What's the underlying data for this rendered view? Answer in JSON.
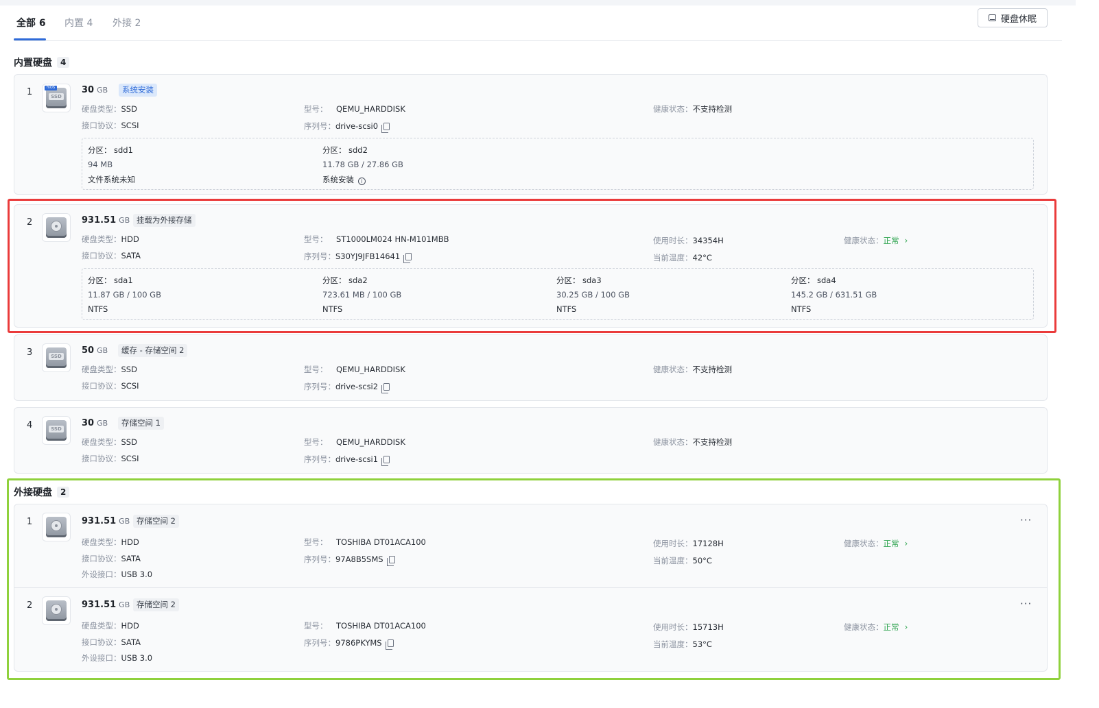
{
  "tabs": [
    {
      "label": "全部 6"
    },
    {
      "label": "内置 4"
    },
    {
      "label": "外接 2"
    }
  ],
  "sleep_button": "硬盘休眠",
  "labels": {
    "disk_type": "硬盘类型：",
    "model": "型号：",
    "health": "健康状态：",
    "interface": "接口协议：",
    "serial": "序列号：",
    "usage": "使用时长：",
    "temp": "当前温度：",
    "ext_port": "外设接口：",
    "partition": "分区："
  },
  "internal": {
    "title": "内置硬盘",
    "count": "4",
    "disks": [
      {
        "index": "1",
        "size": "30",
        "unit": "GB",
        "tag": "系统安装",
        "icon_badge": "fnOS",
        "icon_label": "SSD",
        "type": "SSD",
        "interface": "SCSI",
        "model": "QEMU_HARDDISK",
        "serial": "drive-scsi0",
        "health": "不支持检测",
        "partitions": [
          {
            "name": "sdd1",
            "size": "94 MB",
            "fs": "文件系统未知"
          },
          {
            "name": "sdd2",
            "size": "11.78 GB / 27.86 GB",
            "fs": "系统安装"
          }
        ]
      },
      {
        "index": "2",
        "size": "931.51",
        "unit": "GB",
        "tag": "挂载为外接存储",
        "type": "HDD",
        "interface": "SATA",
        "model": "ST1000LM024 HN-M101MBB",
        "serial": "S30YJ9JFB14641",
        "usage": "34354H",
        "temp": "42°C",
        "health": "正常",
        "partitions": [
          {
            "name": "sda1",
            "size": "11.87 GB / 100 GB",
            "fs": "NTFS"
          },
          {
            "name": "sda2",
            "size": "723.61 MB / 100 GB",
            "fs": "NTFS"
          },
          {
            "name": "sda3",
            "size": "30.25 GB / 100 GB",
            "fs": "NTFS"
          },
          {
            "name": "sda4",
            "size": "145.2 GB / 631.51 GB",
            "fs": "NTFS"
          }
        ]
      },
      {
        "index": "3",
        "size": "50",
        "unit": "GB",
        "tag": "缓存 - 存储空间 2",
        "icon_label": "SSD",
        "type": "SSD",
        "interface": "SCSI",
        "model": "QEMU_HARDDISK",
        "serial": "drive-scsi2",
        "health": "不支持检测"
      },
      {
        "index": "4",
        "size": "30",
        "unit": "GB",
        "tag": "存储空间 1",
        "icon_label": "SSD",
        "type": "SSD",
        "interface": "SCSI",
        "model": "QEMU_HARDDISK",
        "serial": "drive-scsi1",
        "health": "不支持检测"
      }
    ]
  },
  "external": {
    "title": "外接硬盘",
    "count": "2",
    "disks": [
      {
        "index": "1",
        "size": "931.51",
        "unit": "GB",
        "tag": "存储空间 2",
        "type": "HDD",
        "interface": "SATA",
        "ext_port": "USB 3.0",
        "model": "TOSHIBA DT01ACA100",
        "serial": "97A8B5SMS",
        "usage": "17128H",
        "temp": "50°C",
        "health": "正常"
      },
      {
        "index": "2",
        "size": "931.51",
        "unit": "GB",
        "tag": "存储空间 2",
        "type": "HDD",
        "interface": "SATA",
        "ext_port": "USB 3.0",
        "model": "TOSHIBA DT01ACA100",
        "serial": "9786PKYMS",
        "usage": "15713H",
        "temp": "53°C",
        "health": "正常"
      }
    ]
  },
  "colors": {
    "accent": "#2f6bd8",
    "health_ok": "#2ea44f",
    "highlight_red": "#ea3b3b",
    "highlight_green": "#8fd13c"
  }
}
